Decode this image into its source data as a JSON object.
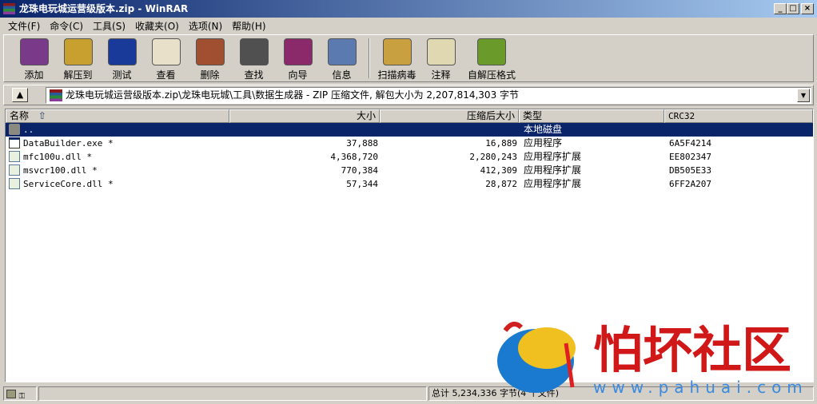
{
  "window": {
    "title": "龙珠电玩城运营级版本.zip - WinRAR",
    "min": "_",
    "max": "□",
    "close": "×"
  },
  "menu": [
    "文件(F)",
    "命令(C)",
    "工具(S)",
    "收藏夹(O)",
    "选项(N)",
    "帮助(H)"
  ],
  "toolbar": [
    {
      "label": "添加",
      "icon": "add-archive-icon",
      "color": "#7a3a8a"
    },
    {
      "label": "解压到",
      "icon": "extract-to-icon",
      "color": "#c8a030"
    },
    {
      "label": "测试",
      "icon": "test-icon",
      "color": "#1a3a9a"
    },
    {
      "label": "查看",
      "icon": "view-icon",
      "color": "#e8e0c8"
    },
    {
      "label": "删除",
      "icon": "delete-icon",
      "color": "#a05030"
    },
    {
      "label": "查找",
      "icon": "find-icon",
      "color": "#505050"
    },
    {
      "label": "向导",
      "icon": "wizard-icon",
      "color": "#8a2a6a"
    },
    {
      "label": "信息",
      "icon": "info-icon",
      "color": "#5a7ab0"
    },
    {
      "label": "扫描病毒",
      "icon": "virus-scan-icon",
      "color": "#c8a040"
    },
    {
      "label": "注释",
      "icon": "comment-icon",
      "color": "#e0d8b0"
    },
    {
      "label": "自解压格式",
      "icon": "sfx-icon",
      "color": "#6a9a2a"
    }
  ],
  "address": {
    "path": "龙珠电玩城运营级版本.zip\\龙珠电玩城\\工具\\数据生成器 - ZIP 压缩文件, 解包大小为 2,207,814,303 字节"
  },
  "columns": {
    "name": "名称",
    "size": "大小",
    "packed": "压缩后大小",
    "type": "类型",
    "crc": "CRC32"
  },
  "rows": [
    {
      "name": "..",
      "size": "",
      "packed": "",
      "type": "本地磁盘",
      "crc": "",
      "icon": "folder-up-icon"
    },
    {
      "name": "DataBuilder.exe *",
      "size": "37,888",
      "packed": "16,889",
      "type": "应用程序",
      "crc": "6A5F4214",
      "icon": "exe-icon"
    },
    {
      "name": "mfc100u.dll *",
      "size": "4,368,720",
      "packed": "2,280,243",
      "type": "应用程序扩展",
      "crc": "EE802347",
      "icon": "dll-icon"
    },
    {
      "name": "msvcr100.dll *",
      "size": "770,384",
      "packed": "412,309",
      "type": "应用程序扩展",
      "crc": "DB505E33",
      "icon": "dll-icon"
    },
    {
      "name": "ServiceCore.dll *",
      "size": "57,344",
      "packed": "28,872",
      "type": "应用程序扩展",
      "crc": "6FF2A207",
      "icon": "dll-icon"
    }
  ],
  "status": {
    "total": "总计 5,234,336 字节(4 个文件)"
  },
  "watermark": {
    "text": "怕坏社区",
    "url": "www.pahuai.com"
  }
}
